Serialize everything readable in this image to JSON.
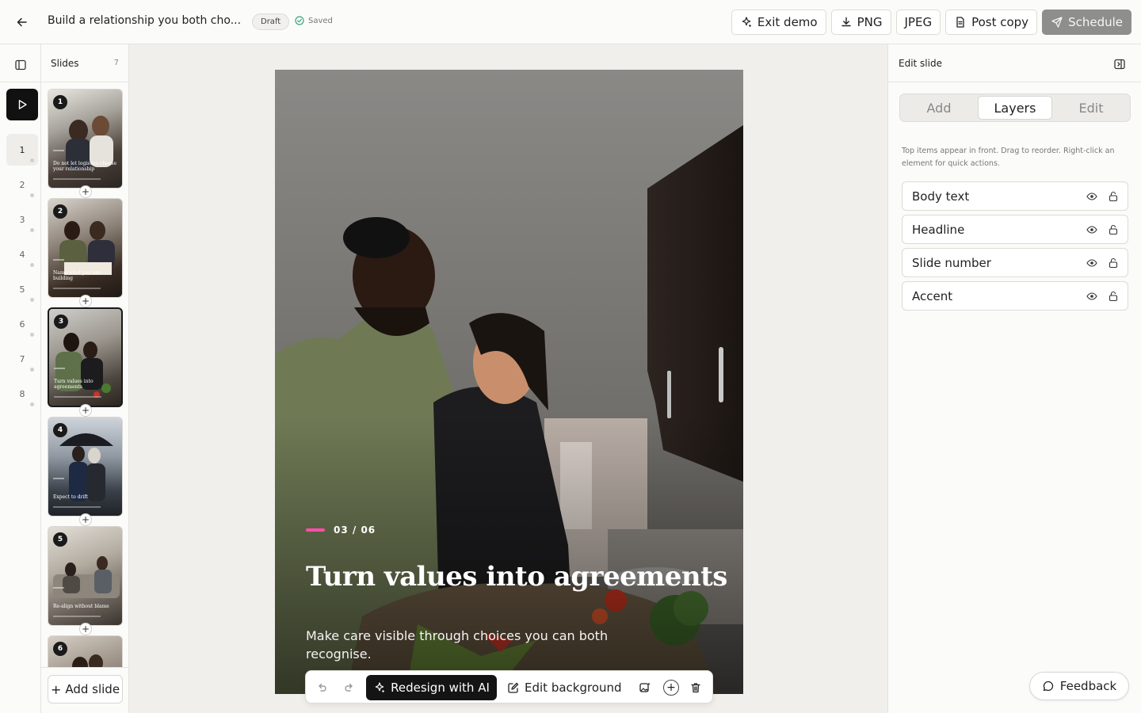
{
  "header": {
    "title": "Build a relationship you both cho...",
    "badge": "Draft",
    "status": "Saved",
    "actions": {
      "exit_demo": "Exit demo",
      "png": "PNG",
      "jpeg": "JPEG",
      "post_copy": "Post copy",
      "schedule": "Schedule"
    }
  },
  "rail": {
    "numbers": [
      "1",
      "2",
      "3",
      "4",
      "5",
      "6",
      "7",
      "8"
    ],
    "active": "1"
  },
  "slides_panel": {
    "title": "Slides",
    "count": "7",
    "thumbnails": [
      {
        "num": "1",
        "caption": "Do not let logistics choose your relationship"
      },
      {
        "num": "2",
        "caption": "Name what you are building"
      },
      {
        "num": "3",
        "caption": "Turn values into agreements"
      },
      {
        "num": "4",
        "caption": "Expect to drift"
      },
      {
        "num": "5",
        "caption": "Re-align without blame"
      },
      {
        "num": "6",
        "caption": ""
      }
    ],
    "add_slide": "Add slide"
  },
  "slide": {
    "number": "03 / 06",
    "headline": "Turn values into agreements",
    "body": "Make care visible through choices you can both recognise.",
    "accent_color": "#ff4fa8"
  },
  "floating_toolbar": {
    "redesign": "Redesign with AI",
    "edit_background": "Edit background"
  },
  "right_panel": {
    "title": "Edit slide",
    "tabs": [
      "Add",
      "Layers",
      "Edit"
    ],
    "active_tab": "Layers",
    "help_text": "Top items appear in front. Drag to reorder. Right-click an element for quick actions.",
    "layers": [
      "Body text",
      "Headline",
      "Slide number",
      "Accent"
    ],
    "feedback": "Feedback"
  }
}
